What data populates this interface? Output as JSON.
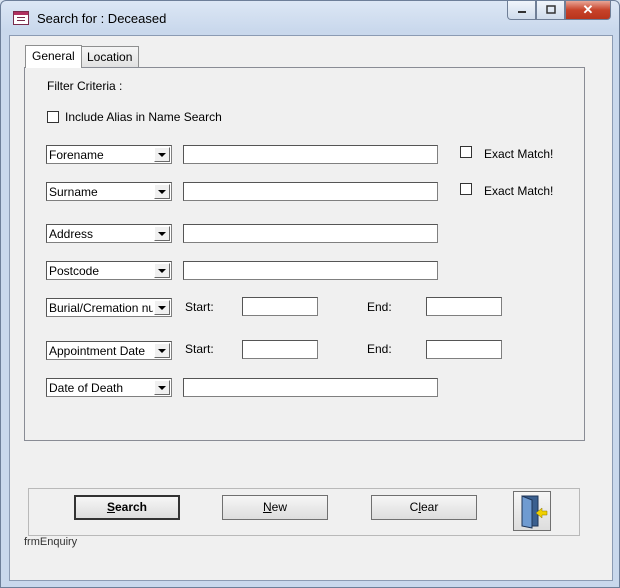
{
  "window": {
    "title": "Search for : Deceased",
    "minimize_icon": "minimize-icon",
    "maximize_icon": "maximize-icon",
    "close_label": "✕"
  },
  "tabs": [
    {
      "label": "General",
      "active": true
    },
    {
      "label": "Location",
      "active": false
    }
  ],
  "filter": {
    "heading": "Filter Criteria :",
    "include_alias_label": "Include Alias in Name Search",
    "include_alias_checked": false
  },
  "rows": {
    "forename": {
      "field": "Forename",
      "value": "",
      "exact_match_label": "Exact Match!",
      "exact_match_checked": false
    },
    "surname": {
      "field": "Surname",
      "value": "",
      "exact_match_label": "Exact Match!",
      "exact_match_checked": false
    },
    "address": {
      "field": "Address",
      "value": ""
    },
    "postcode": {
      "field": "Postcode",
      "value": ""
    },
    "burial": {
      "field": "Burial/Cremation nu",
      "start_label": "Start:",
      "start_value": "",
      "end_label": "End:",
      "end_value": ""
    },
    "appointment": {
      "field": "Appointment Date",
      "start_label": "Start:",
      "start_value": "",
      "end_label": "End:",
      "end_value": ""
    },
    "date_of_death": {
      "field": "Date of Death",
      "value": ""
    }
  },
  "buttons": {
    "search": {
      "text": "Search",
      "mnemonic": "S"
    },
    "new": {
      "text": "New",
      "mnemonic": "N"
    },
    "clear": {
      "text": "Clear",
      "mnemonic": "l"
    },
    "exit_icon": "exit-door-icon"
  },
  "form_name": "frmEnquiry",
  "colors": {
    "close_button": "#c7432a",
    "title_icon": "#b03060",
    "exit_arrow": "#f0d000"
  }
}
